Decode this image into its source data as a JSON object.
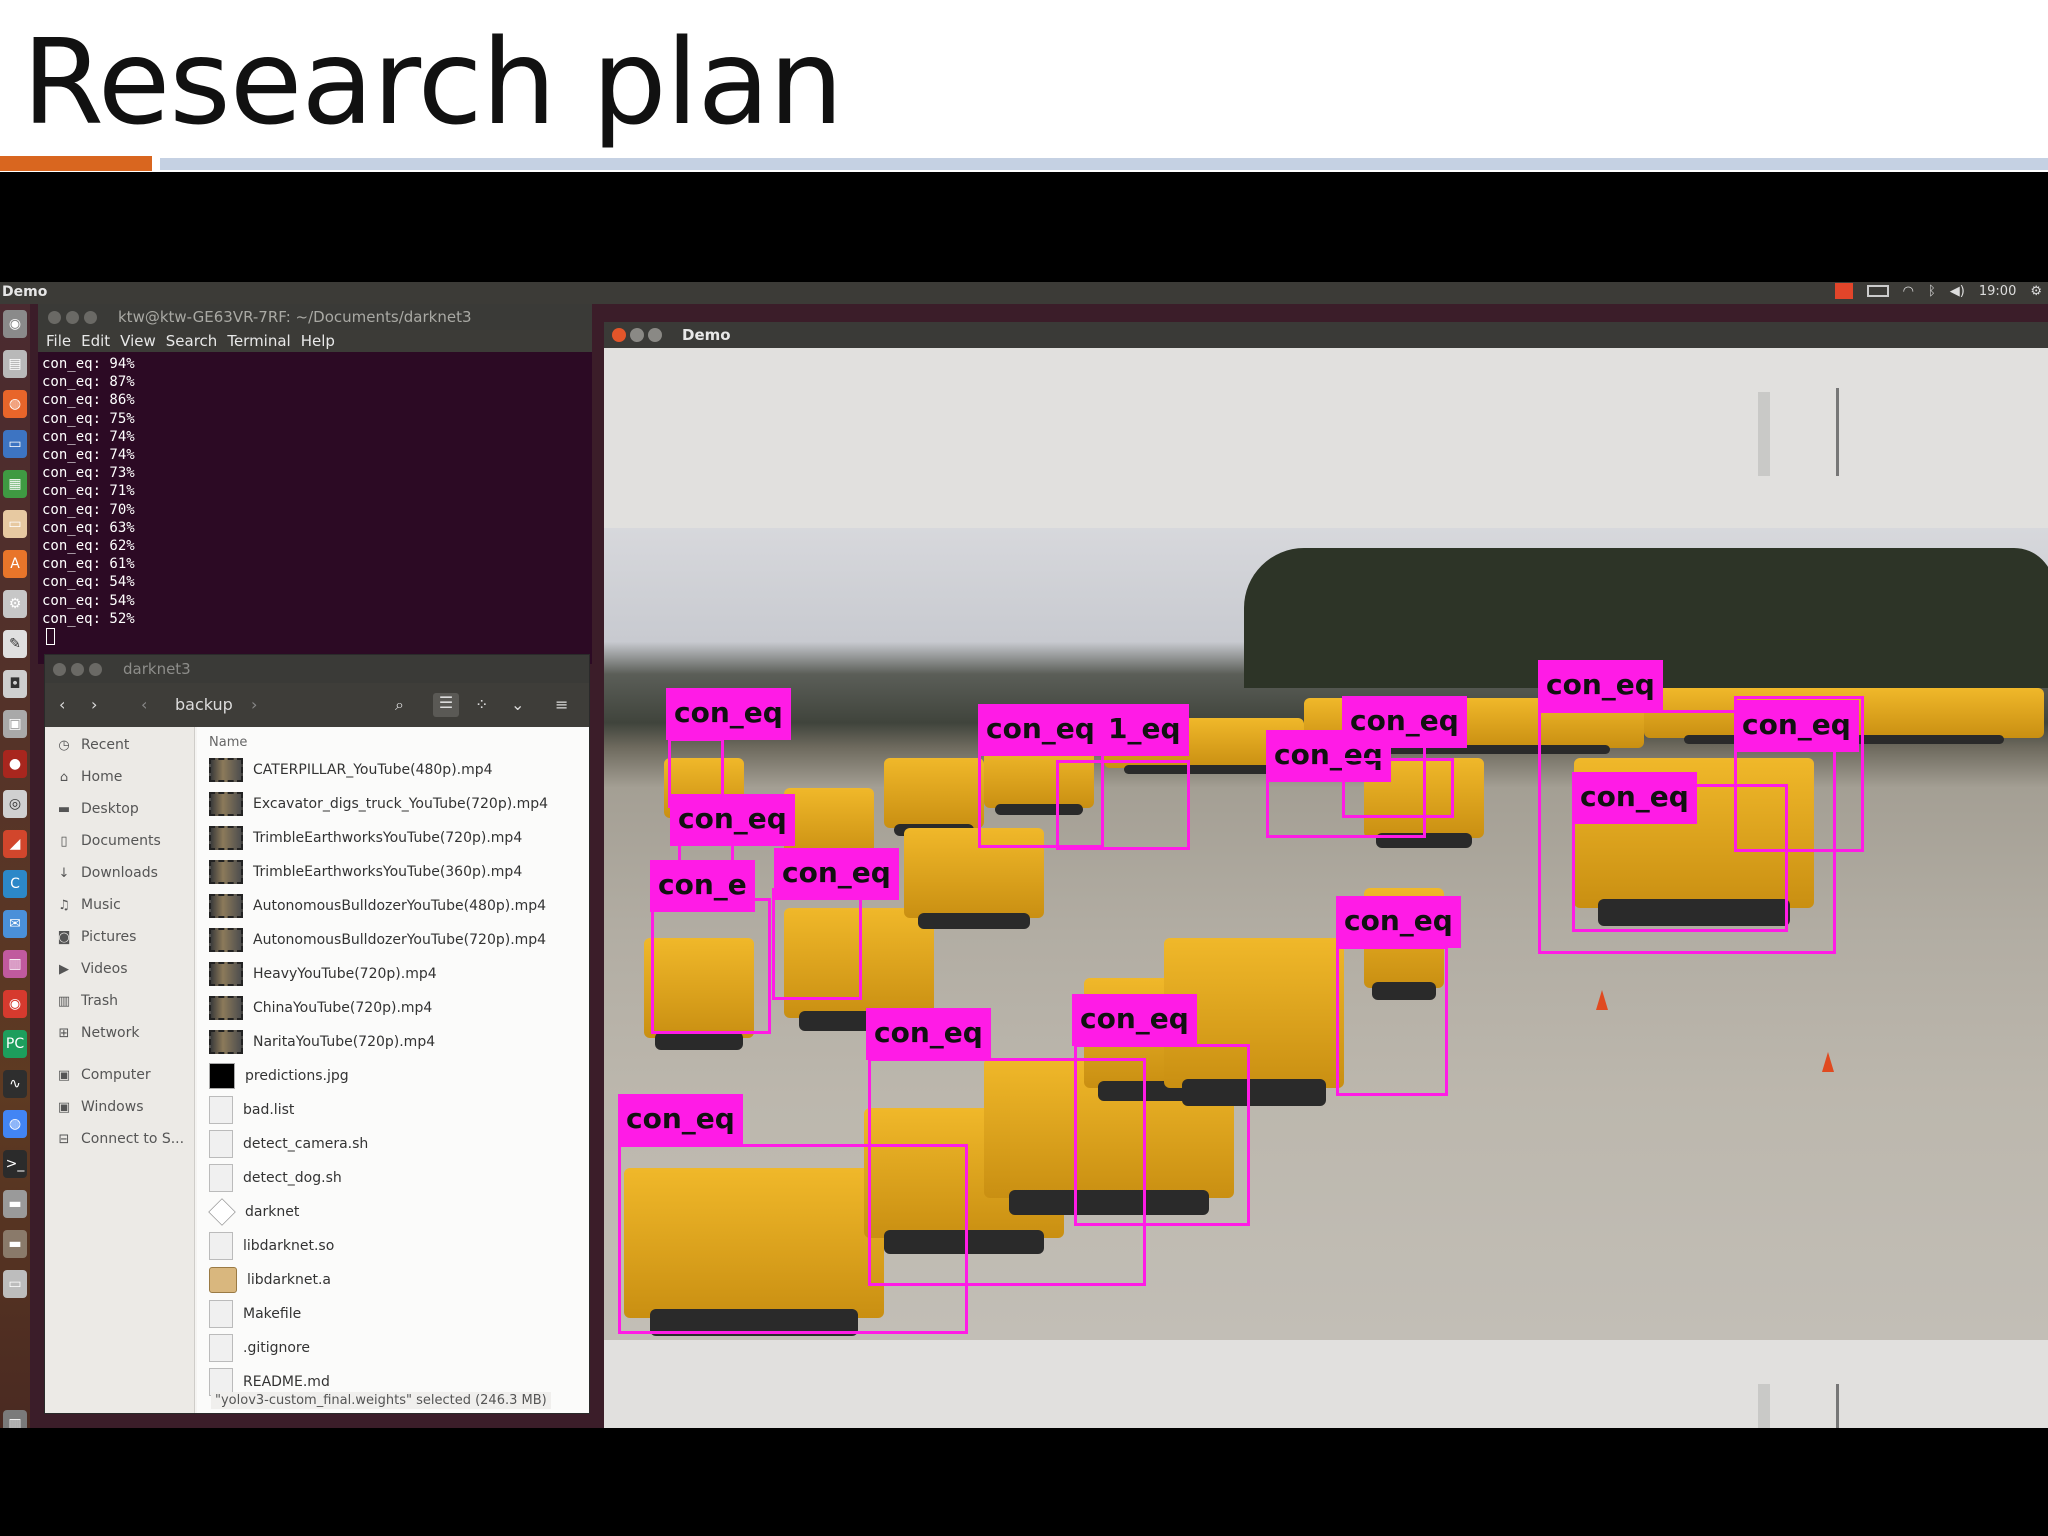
{
  "slide": {
    "title": "Research plan"
  },
  "topbar": {
    "app_title": "Demo",
    "clock": "19:00"
  },
  "terminal": {
    "title": "ktw@ktw-GE63VR-7RF: ~/Documents/darknet3",
    "menu": [
      "File",
      "Edit",
      "View",
      "Search",
      "Terminal",
      "Help"
    ],
    "lines": [
      "con_eq: 94%",
      "con_eq: 87%",
      "con_eq: 86%",
      "con_eq: 75%",
      "con_eq: 74%",
      "con_eq: 74%",
      "con_eq: 73%",
      "con_eq: 71%",
      "con_eq: 70%",
      "con_eq: 63%",
      "con_eq: 62%",
      "con_eq: 61%",
      "con_eq: 54%",
      "con_eq: 54%",
      "con_eq: 52%"
    ]
  },
  "files": {
    "title": "darknet3",
    "path": "backup",
    "column_name": "Name",
    "sidebar": [
      "Recent",
      "Home",
      "Desktop",
      "Documents",
      "Downloads",
      "Music",
      "Pictures",
      "Videos",
      "Trash",
      "Network",
      "Computer",
      "Windows",
      "Connect to S..."
    ],
    "items": [
      "CATERPILLAR_YouTube(480p).mp4",
      "Excavator_digs_truck_YouTube(720p).mp4",
      "TrimbleEarthworksYouTube(720p).mp4",
      "TrimbleEarthworksYouTube(360p).mp4",
      "AutonomousBulldozerYouTube(480p).mp4",
      "AutonomousBulldozerYouTube(720p).mp4",
      "HeavyYouTube(720p).mp4",
      "ChinaYouTube(720p).mp4",
      "NaritaYouTube(720p).mp4",
      "predictions.jpg",
      "bad.list",
      "detect_camera.sh",
      "detect_dog.sh",
      "darknet",
      "libdarknet.so",
      "libdarknet.a",
      "Makefile",
      ".gitignore",
      "README.md"
    ],
    "status": "\"yolov3-custom_final.weights\" selected (246.3 MB)"
  },
  "demo": {
    "title": "Demo",
    "detection_label": "con_eq",
    "partial_labels": [
      "1_eq",
      "con_e"
    ]
  },
  "colors": {
    "detection": "#ff1be6",
    "accent_orange": "#d9661f",
    "accent_blue": "#c5d1e3"
  }
}
